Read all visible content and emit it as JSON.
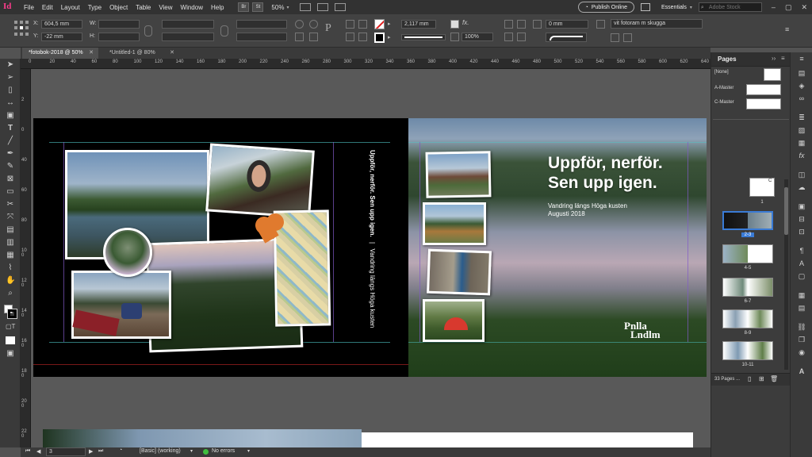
{
  "menubar": {
    "app_icon": "Id",
    "items": [
      "File",
      "Edit",
      "Layout",
      "Type",
      "Object",
      "Table",
      "View",
      "Window",
      "Help"
    ],
    "bridge_label": "Br",
    "stock_label": "St",
    "zoom": "50%",
    "publish_label": "Publish Online",
    "workspace": "Essentials",
    "search_placeholder": "Adobe Stock"
  },
  "control": {
    "x_label": "X:",
    "x_value": "604,5 mm",
    "y_label": "Y:",
    "y_value": "-22 mm",
    "w_label": "W:",
    "h_label": "H:",
    "stroke_weight": "2,117 mm",
    "opacity": "100%",
    "corner": "0 mm",
    "object_style": "vit fotoram m skugga"
  },
  "tabs": [
    {
      "label": "*fotobok-2018 @ 50%"
    },
    {
      "label": "*Untitled-1 @ 80%"
    }
  ],
  "ruler_h": [
    "0",
    "20",
    "40",
    "60",
    "80",
    "100",
    "120",
    "140",
    "160",
    "180",
    "200",
    "220",
    "240",
    "260",
    "280",
    "300",
    "320",
    "340",
    "360",
    "380",
    "400",
    "420",
    "440",
    "460",
    "480",
    "500",
    "520",
    "540",
    "560",
    "580",
    "600",
    "620",
    "640"
  ],
  "ruler_v": [
    "2",
    "0",
    "40",
    "60",
    "80",
    "100",
    "120",
    "140",
    "160",
    "180",
    "200",
    "220"
  ],
  "spread": {
    "spine_title": "Uppför, nerför. Sen upp igen.",
    "spine_sub": "Vandring längs Höga kusten",
    "headline_line1": "Uppför, nerför.",
    "headline_line2": "Sen upp igen.",
    "subtitle_line1": "Vandring längs Höga kusten",
    "subtitle_line2": "Augusti 2018",
    "logo_line1": "Pnlla",
    "logo_line2": "Lndlm"
  },
  "status": {
    "page": "3",
    "style": "[Basic] (working)",
    "errors": "No errors"
  },
  "pages_panel": {
    "title": "Pages",
    "masters": [
      "[None]",
      "A-Master",
      "C-Master"
    ],
    "page1": "1",
    "spreads": [
      "2-3",
      "4-5",
      "6-7",
      "8-9",
      "10-11"
    ],
    "footer": "33 Pages ..."
  }
}
